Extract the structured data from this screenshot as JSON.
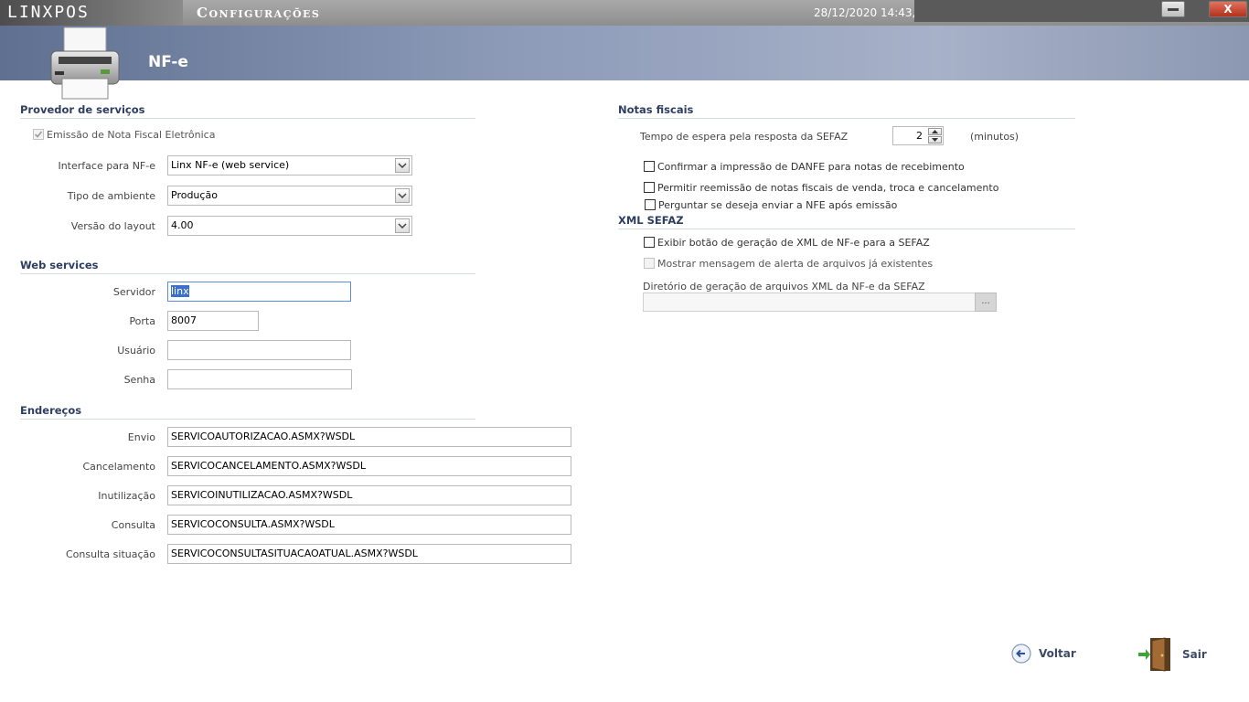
{
  "window": {
    "app_logo": "LINXPOS",
    "title": "Configurações",
    "clock": "28/12/2020 14:43,",
    "minimize_label": "",
    "close_label": "X"
  },
  "header": {
    "page_title": "NF-e",
    "icon": "printer-icon"
  },
  "provider": {
    "section_title": "Provedor de serviços",
    "emissao_label": "Emissão de Nota Fiscal Eletrônica",
    "emissao_checked": true,
    "interface_label": "Interface para NF-e",
    "interface_value": "Linx NF-e (web service)",
    "ambiente_label": "Tipo de ambiente",
    "ambiente_value": "Produção",
    "layout_label": "Versão do layout",
    "layout_value": "4.00"
  },
  "webservices": {
    "section_title": "Web services",
    "servidor_label": "Servidor",
    "servidor_value": "linx",
    "porta_label": "Porta",
    "porta_value": "8007",
    "usuario_label": "Usuário",
    "usuario_value": "",
    "senha_label": "Senha",
    "senha_value": ""
  },
  "enderecos": {
    "section_title": "Endereços",
    "items": [
      {
        "label": "Envio",
        "value": "SERVICOAUTORIZACAO.ASMX?WSDL"
      },
      {
        "label": "Cancelamento",
        "value": "SERVICOCANCELAMENTO.ASMX?WSDL"
      },
      {
        "label": "Inutilização",
        "value": "SERVICOINUTILIZACAO.ASMX?WSDL"
      },
      {
        "label": "Consulta",
        "value": "SERVICOCONSULTA.ASMX?WSDL"
      },
      {
        "label": "Consulta situação",
        "value": "SERVICOCONSULTASITUACAOATUAL.ASMX?WSDL"
      }
    ]
  },
  "notas": {
    "section_title": "Notas fiscais",
    "tempo_label": "Tempo de espera pela resposta da SEFAZ",
    "tempo_value": "2",
    "tempo_unit": "(minutos)",
    "confirmar_label": "Confirmar a impressão de DANFE para notas de recebimento",
    "permitir_label": "Permitir reemissão de notas fiscais de venda, troca e cancelamento",
    "perguntar_label": "Perguntar se deseja enviar a NFE após emissão"
  },
  "xml": {
    "section_title": "XML SEFAZ",
    "exibir_label": "Exibir botão de geração de XML de NF-e para a SEFAZ",
    "mostrar_label": "Mostrar mensagem de alerta de arquivos já existentes",
    "diretorio_label": "Diretório de geração de arquivos XML da NF-e da SEFAZ",
    "diretorio_value": "",
    "browse_label": "..."
  },
  "actions": {
    "voltar_label": "Voltar",
    "sair_label": "Sair"
  },
  "colors": {
    "section_text": "#2e3e60",
    "header_band": "#8c9ab8",
    "close_button": "#c9432c"
  }
}
